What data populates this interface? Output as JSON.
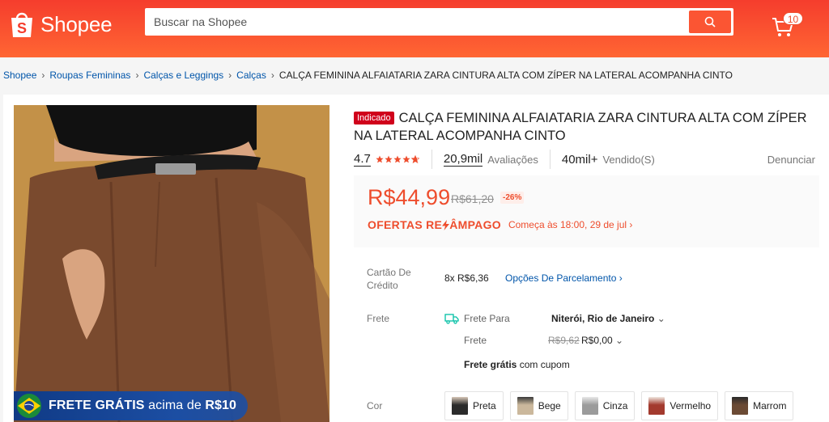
{
  "header": {
    "logo_text": "Shopee",
    "search_placeholder": "Buscar na Shopee",
    "cart_count": "10",
    "bg_color": "#f53d2d"
  },
  "breadcrumb": {
    "items": [
      "Shopee",
      "Roupas Femininas",
      "Calças e Leggings",
      "Calças"
    ],
    "current": "CALÇA FEMININA ALFAIATARIA ZARA CINTURA ALTA COM ZÍPER NA LATERAL ACOMPANHA CINTO"
  },
  "product": {
    "tag": "Indicado",
    "title_line1": "CALÇA FEMININA ALFAIATARIA ZARA CINTURA ALTA COM ZÍPER",
    "title_line2": "NA LATERAL ACOMPANHA CINTO",
    "rating": "4.7",
    "rating_stars": 4.7,
    "reviews_count": "20,9mil",
    "reviews_label": "Avaliações",
    "sold_count": "40mil+",
    "sold_label": "Vendido(S)",
    "report_label": "Denunciar"
  },
  "image_badge": {
    "bold": "FRETE GRÁTIS",
    "light": "acima de",
    "amount": "R$10"
  },
  "price": {
    "current": "R$44,99",
    "original": "R$61,20",
    "discount": "-26%",
    "flash_title_a": "OFERTAS RE",
    "flash_title_b": "ÂMPAGO",
    "flash_time": "Começa às 18:00, 29 de jul"
  },
  "installments": {
    "label_line1": "Cartão De",
    "label_line2": "Crédito",
    "value": "8x R$6,36",
    "options_link": "Opções De Parcelamento"
  },
  "shipping": {
    "label": "Frete",
    "to_label": "Frete Para",
    "destination": "Niterói, Rio de Janeiro",
    "fee_label": "Frete",
    "fee_old": "R$9,62",
    "fee_new": "R$0,00",
    "free_bold": "Frete grátis",
    "free_rest": "com cupom"
  },
  "colors": {
    "label": "Cor",
    "options": [
      "Preta",
      "Bege",
      "Cinza",
      "Vermelho",
      "Marrom"
    ],
    "swatches": [
      "#2b2b2b",
      "#cbb89c",
      "#9b9b9b",
      "#a33a2e",
      "#6b4a34"
    ]
  },
  "theme": {
    "accent": "#ee4d2d",
    "link": "#0055aa"
  }
}
